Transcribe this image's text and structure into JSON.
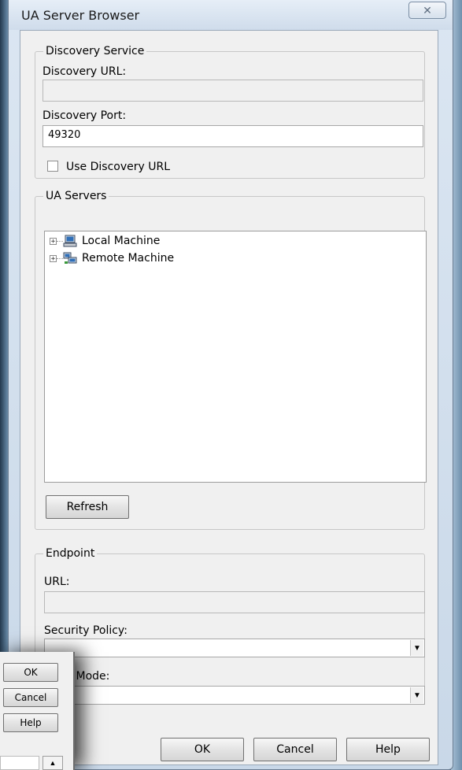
{
  "window": {
    "title": "UA Server Browser",
    "close_label": "✕"
  },
  "discovery": {
    "legend": "Discovery Service",
    "url_label": "Discovery URL:",
    "url_value": "",
    "port_label": "Discovery Port:",
    "port_value": "49320",
    "use_url_label": "Use Discovery URL",
    "use_url_checked": false
  },
  "servers": {
    "legend": "UA Servers",
    "nodes": [
      {
        "label": "Local Machine",
        "icon": "computer-icon",
        "expander": "+"
      },
      {
        "label": "Remote Machine",
        "icon": "network-computers-icon",
        "expander": "+"
      }
    ],
    "refresh_label": "Refresh"
  },
  "endpoint": {
    "legend": "Endpoint",
    "url_label": "URL:",
    "url_value": "",
    "security_policy_label": "Security Policy:",
    "security_policy_value": "",
    "message_mode_label_visible": "age Mode:",
    "message_mode_value": ""
  },
  "buttons": {
    "ok": "OK",
    "cancel": "Cancel",
    "help": "Help"
  },
  "background_window": {
    "ok": "OK",
    "cancel": "Cancel",
    "help": "Help",
    "scroll_up": "▲"
  },
  "colors": {
    "client_bg": "#f0f0f0",
    "titlebar": "#dbe6f2",
    "desktop": "#3c5e7a"
  }
}
